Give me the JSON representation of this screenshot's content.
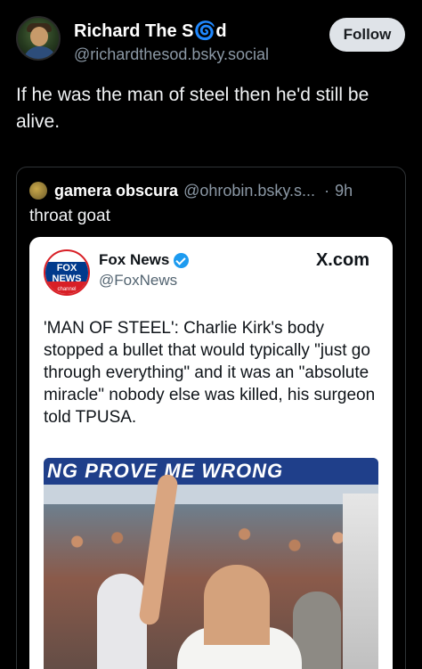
{
  "post": {
    "display_name": "Richard The S🌀d",
    "handle": "@richardthesod.bsky.social",
    "follow_label": "Follow",
    "text": "If he was the man of steel then he'd still be alive."
  },
  "quote": {
    "name": "gamera obscura",
    "handle": "@ohrobin.bsky.s...",
    "separator": "·",
    "time": "9h",
    "text": "throat goat"
  },
  "embed": {
    "logo_text": "FOX NEWS",
    "logo_sub": "channel",
    "name": "Fox News",
    "handle": "@FoxNews",
    "source": "X.com",
    "text": "'MAN OF STEEL': Charlie Kirk's body stopped a bullet that would typically \"just go through everything\" and it was an \"absolute miracle\" nobody else was killed, his surgeon told TPUSA.",
    "photo_banner": "NG PROVE ME WRONG"
  }
}
